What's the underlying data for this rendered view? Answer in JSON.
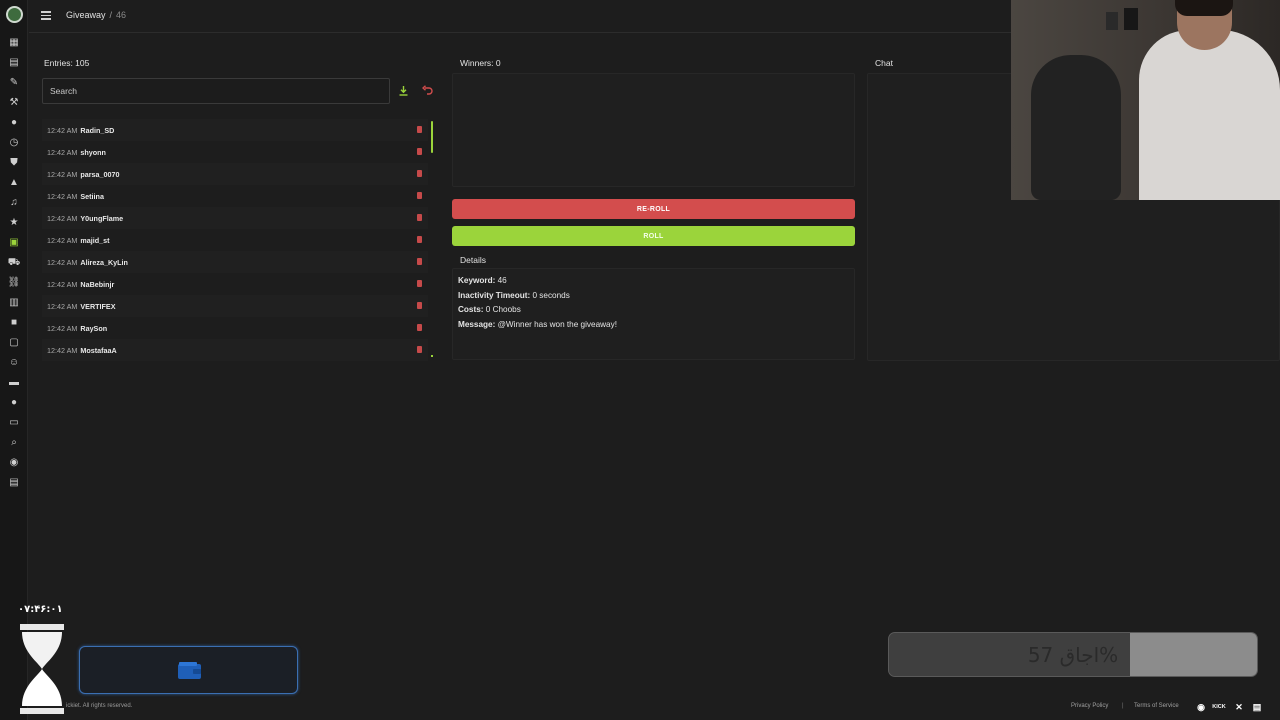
{
  "topbar": {
    "title": "Giveaway",
    "separator": "/",
    "keyword_crumb": "46"
  },
  "sidebar": {
    "items": [
      {
        "icon": "dashboard-icon"
      },
      {
        "icon": "document-icon"
      },
      {
        "icon": "pen-icon"
      },
      {
        "icon": "hammer-icon"
      },
      {
        "icon": "chat-bubble-icon"
      },
      {
        "icon": "clock-icon"
      },
      {
        "icon": "shield-icon"
      },
      {
        "icon": "warning-icon"
      },
      {
        "icon": "music-note-icon"
      },
      {
        "icon": "star-icon"
      },
      {
        "icon": "gift-icon",
        "active": true
      },
      {
        "icon": "cart-icon"
      },
      {
        "icon": "link-icon"
      },
      {
        "icon": "bar-chart-icon"
      },
      {
        "icon": "video-icon"
      },
      {
        "icon": "box-icon"
      },
      {
        "icon": "smiley-icon"
      },
      {
        "icon": "film-icon"
      },
      {
        "icon": "message-icon"
      },
      {
        "icon": "monitor-icon"
      },
      {
        "icon": "magnifier-icon"
      },
      {
        "icon": "discord-icon"
      },
      {
        "icon": "card-icon"
      }
    ]
  },
  "entries_panel": {
    "label": "Entries: 105",
    "search_placeholder": "Search",
    "download_icon": "download-icon",
    "reset_icon": "undo-icon",
    "accent": "#9bd43b",
    "delete_color": "#c64a4a",
    "rows": [
      {
        "time": "12:42 AM",
        "user": "Radin_SD"
      },
      {
        "time": "12:42 AM",
        "user": "shyonn"
      },
      {
        "time": "12:42 AM",
        "user": "parsa_0070"
      },
      {
        "time": "12:42 AM",
        "user": "Setiina"
      },
      {
        "time": "12:42 AM",
        "user": "Y0ungFlame"
      },
      {
        "time": "12:42 AM",
        "user": "majid_st"
      },
      {
        "time": "12:42 AM",
        "user": "Alireza_KyLin"
      },
      {
        "time": "12:42 AM",
        "user": "NaBebinjr"
      },
      {
        "time": "12:42 AM",
        "user": "VERTIFEX"
      },
      {
        "time": "12:42 AM",
        "user": "RaySon"
      },
      {
        "time": "12:42 AM",
        "user": "MostafaaA"
      }
    ]
  },
  "winners_panel": {
    "label": "Winners: 0"
  },
  "actions": {
    "reroll_label": "RE-ROLL",
    "roll_label": "ROLL",
    "reroll_color": "#d34d4d",
    "roll_color": "#9bd43b"
  },
  "details": {
    "label": "Details",
    "keyword_key": "Keyword:",
    "keyword_value": "46",
    "timeout_key": "Inactivity Timeout:",
    "timeout_value": "0 seconds",
    "costs_key": "Costs:",
    "costs_value": "0 Choobs",
    "message_key": "Message:",
    "message_value": "@Winner has won the giveaway!"
  },
  "chat_panel": {
    "label": "Chat"
  },
  "overlay": {
    "timer": "۰۷:۴۶:۰۱",
    "wallet_icon": "wallet-icon",
    "wallet_color": "#3b6fb2",
    "progress_text": "اجاق 57%",
    "progress_fraction": 0.57
  },
  "footer": {
    "copyright": "ickiet. All rights reserved.",
    "privacy": "Privacy Policy",
    "divider": "|",
    "terms": "Terms of Service",
    "icons": [
      "discord-icon",
      "kick-icon",
      "x-icon",
      "document-icon"
    ],
    "kick_text": "KICK"
  }
}
